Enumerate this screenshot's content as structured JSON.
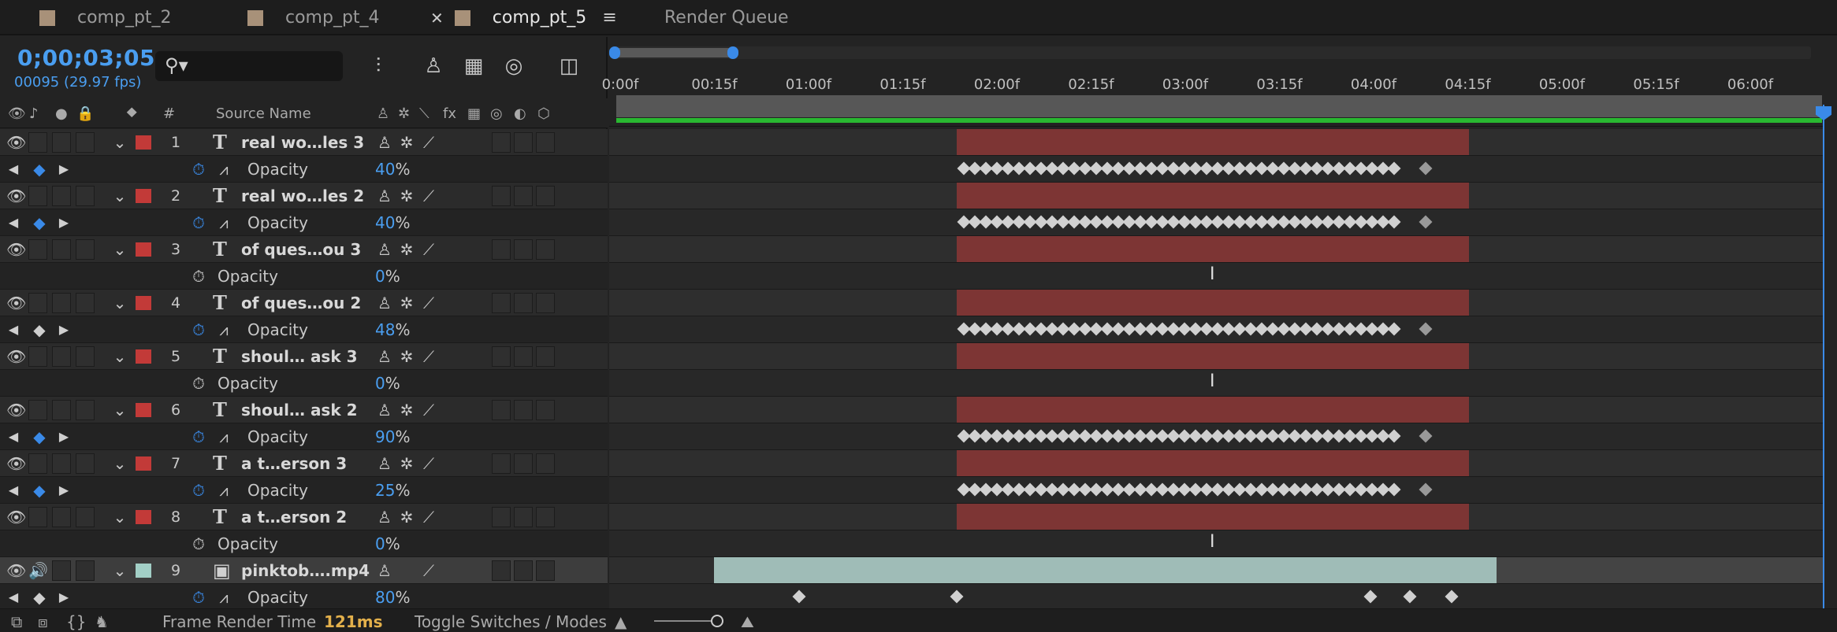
{
  "tabs": [
    {
      "label": "comp_pt_2",
      "active": false
    },
    {
      "label": "comp_pt_4",
      "active": false
    },
    {
      "label": "comp_pt_5",
      "active": true
    },
    {
      "label": "Render Queue",
      "active": false
    }
  ],
  "timecode": "0;00;03;05",
  "frame_info": "00095 (29.97 fps)",
  "columns": {
    "number": "#",
    "source_name": "Source Name"
  },
  "ruler_labels": [
    "0:00f",
    "00:15f",
    "01:00f",
    "01:15f",
    "02:00f",
    "02:15f",
    "03:00f",
    "03:15f",
    "04:00f",
    "04:15f",
    "05:00f",
    "05:15f",
    "06:00f"
  ],
  "layers": [
    {
      "num": "1",
      "name": "real wo…les 3",
      "prop": "Opacity",
      "value": "40",
      "unit": "%",
      "keyframed": true
    },
    {
      "num": "2",
      "name": "real wo…les 2",
      "prop": "Opacity",
      "value": "40",
      "unit": "%",
      "keyframed": true
    },
    {
      "num": "3",
      "name": "of ques…ou  3",
      "prop": "Opacity",
      "value": "0",
      "unit": "%",
      "keyframed": false
    },
    {
      "num": "4",
      "name": "of ques…ou  2",
      "prop": "Opacity",
      "value": "48",
      "unit": "%",
      "keyframed": true
    },
    {
      "num": "5",
      "name": "shoul… ask  3",
      "prop": "Opacity",
      "value": "0",
      "unit": "%",
      "keyframed": false
    },
    {
      "num": "6",
      "name": "shoul… ask  2",
      "prop": "Opacity",
      "value": "90",
      "unit": "%",
      "keyframed": true
    },
    {
      "num": "7",
      "name": "a t…erson 3",
      "prop": "Opacity",
      "value": "25",
      "unit": "%",
      "keyframed": true
    },
    {
      "num": "8",
      "name": "a t…erson 2",
      "prop": "Opacity",
      "value": "0",
      "unit": "%",
      "keyframed": false
    },
    {
      "num": "9",
      "name": "pinktob….mp4",
      "prop": "Opacity",
      "value": "80",
      "unit": "%",
      "keyframed": true
    }
  ],
  "bottom": {
    "frame_render_label": "Frame Render Time",
    "frame_render_value": "121ms",
    "toggle_label": "Toggle Switches / Modes"
  },
  "colors": {
    "accent": "#3a8ae8",
    "label_red": "#c23a38",
    "label_teal": "#a2cfc6",
    "bar_red": "#7d3534",
    "bar_teal": "#9fbcb7",
    "work_area_green": "#29b831"
  }
}
